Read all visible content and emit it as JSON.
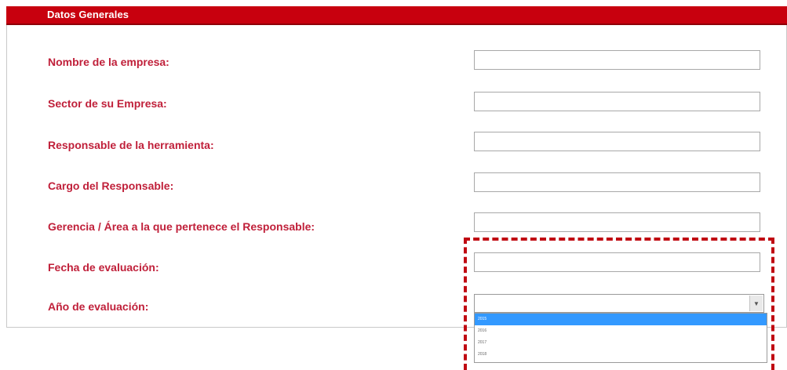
{
  "panel": {
    "title": "Datos Generales"
  },
  "fields": [
    {
      "label": "Nombre de la empresa:",
      "value": ""
    },
    {
      "label": "Sector de su Empresa:",
      "value": ""
    },
    {
      "label": "Responsable de la herramienta:",
      "value": ""
    },
    {
      "label": "Cargo del Responsable:",
      "value": ""
    },
    {
      "label": "Gerencia / Área a la que pertenece el Responsable:",
      "value": ""
    },
    {
      "label": "Fecha de evaluación:",
      "value": ""
    }
  ],
  "year_select": {
    "label": "Año de evaluación:",
    "selected": "",
    "options": [
      "2015",
      "2016",
      "2017",
      "2018"
    ],
    "highlighted_index": 0
  },
  "colors": {
    "header_bg": "#c8000e",
    "label_text": "#c0203a",
    "highlight_border": "#c00a12",
    "option_selected_bg": "#3399ff"
  },
  "icons": {
    "select_arrow": "chevron-down-icon"
  }
}
